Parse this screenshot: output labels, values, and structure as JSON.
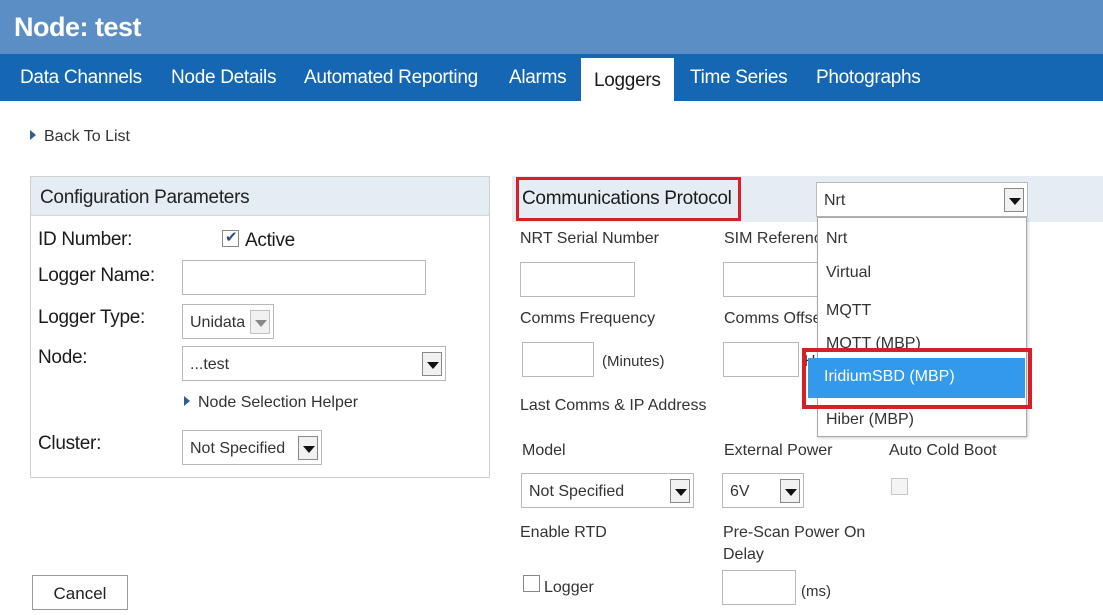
{
  "page": {
    "title": "Node: test"
  },
  "tabs": [
    {
      "label": "Data Channels",
      "active": false
    },
    {
      "label": "Node Details",
      "active": false
    },
    {
      "label": "Automated Reporting",
      "active": false
    },
    {
      "label": "Alarms",
      "active": false
    },
    {
      "label": "Loggers",
      "active": true
    },
    {
      "label": "Time Series",
      "active": false
    },
    {
      "label": "Photographs",
      "active": false
    }
  ],
  "back_link": "Back To List",
  "config": {
    "header": "Configuration Parameters",
    "id_number_label": "ID Number:",
    "active_label": "Active",
    "active_checked": true,
    "logger_name_label": "Logger Name:",
    "logger_name_value": "",
    "logger_type_label": "Logger Type:",
    "logger_type_value": "Unidata",
    "node_label": "Node:",
    "node_value": "...test",
    "node_helper_link": "Node Selection Helper",
    "cluster_label": "Cluster:",
    "cluster_value": "Not Specified"
  },
  "comms": {
    "header": "Communications Protocol",
    "protocol_value": "Nrt",
    "nrt_serial_label": "NRT Serial Number",
    "sim_reference_label": "SIM Referenc",
    "comms_frequency_label": "Comms Frequency",
    "comms_offset_label": "Comms Offse",
    "minutes_unit": "(Minutes)",
    "offset_unit_fragment": "H",
    "last_comms_label": "Last Comms & IP Address",
    "model_label": "Model",
    "model_value": "Not Specified",
    "external_power_label": "External Power",
    "external_power_value": "6V",
    "auto_cold_boot_label": "Auto Cold Boot",
    "auto_cold_boot_checked": false,
    "enable_rtd_label": "Enable RTD",
    "logger_checkbox_label": "Logger",
    "logger_checkbox_checked": false,
    "prescan_label_line1": "Pre-Scan Power On",
    "prescan_label_line2": "Delay",
    "ms_unit": "(ms)"
  },
  "protocol_options": {
    "nrt": "Nrt",
    "virtual": "Virtual",
    "mqtt": "MQTT",
    "mqtt_mbp": "MQTT (MBP)",
    "iridium": "IridiumSBD (MBP)",
    "hiber": "Hiber (MBP)"
  },
  "selected_protocol_option": "IridiumSBD (MBP)",
  "cancel_button": "Cancel",
  "colors": {
    "title_bar": "#5b8ec5",
    "tab_bar": "#1567b3",
    "panel_header": "#e4ecf4",
    "highlight": "#d61f27",
    "dropdown_selection": "#3399ea"
  }
}
